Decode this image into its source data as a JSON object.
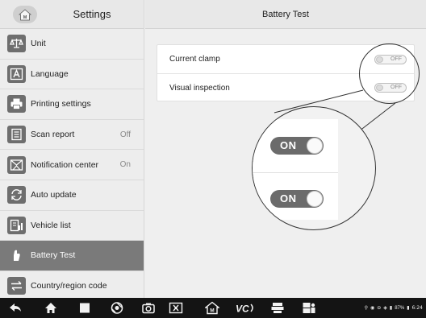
{
  "sidebar": {
    "title": "Settings",
    "items": [
      {
        "label": "Unit",
        "value": "",
        "icon": "scale-icon"
      },
      {
        "label": "Language",
        "value": "",
        "icon": "language-icon"
      },
      {
        "label": "Printing settings",
        "value": "",
        "icon": "printer-icon"
      },
      {
        "label": "Scan report",
        "value": "Off",
        "icon": "report-icon"
      },
      {
        "label": "Notification center",
        "value": "On",
        "icon": "notification-icon"
      },
      {
        "label": "Auto update",
        "value": "",
        "icon": "update-icon"
      },
      {
        "label": "Vehicle list",
        "value": "",
        "icon": "vehicle-list-icon"
      },
      {
        "label": "Battery Test",
        "value": "",
        "icon": "battery-test-icon",
        "active": true
      },
      {
        "label": "Country/region code",
        "value": "",
        "icon": "country-code-icon"
      }
    ]
  },
  "main": {
    "title": "Battery Test",
    "options": [
      {
        "label": "Current clamp",
        "state": "OFF"
      },
      {
        "label": "Visual inspection",
        "state": "OFF"
      }
    ],
    "zoom_toggles": [
      "ON",
      "ON"
    ]
  },
  "taskbar": {
    "icons": [
      "back-icon",
      "home-icon",
      "recent-apps-icon",
      "browser-icon",
      "camera-icon",
      "screenshot-icon",
      "maxi-home-icon",
      "vci-icon",
      "data-manager-icon",
      "shop-manager-icon"
    ],
    "battery": "87%",
    "time": "6:24"
  },
  "colors": {
    "active_bg": "#7a7a7a",
    "toggle_on": "#6b6b6b",
    "taskbar": "#141414"
  }
}
